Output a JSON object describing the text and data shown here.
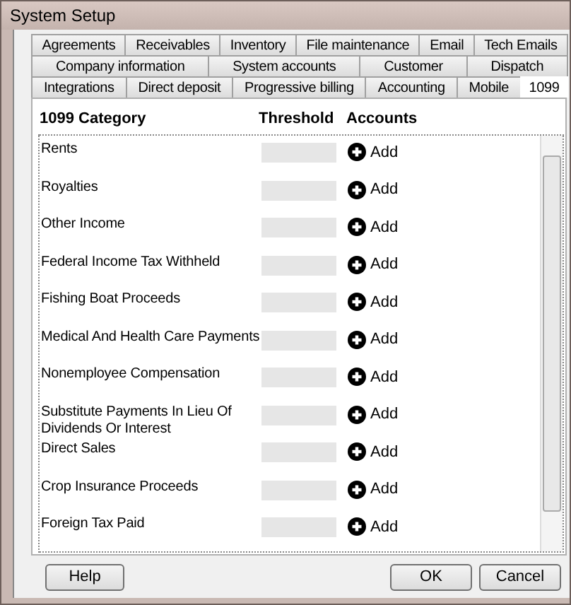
{
  "window": {
    "title": "System Setup"
  },
  "tab_rows": [
    [
      {
        "label": "Agreements",
        "selected": false
      },
      {
        "label": "Receivables",
        "selected": false
      },
      {
        "label": "Inventory",
        "selected": false
      },
      {
        "label": "File maintenance",
        "selected": false
      },
      {
        "label": "Email",
        "selected": false
      },
      {
        "label": "Tech Emails",
        "selected": false
      }
    ],
    [
      {
        "label": "Company information",
        "selected": false
      },
      {
        "label": "System accounts",
        "selected": false
      },
      {
        "label": "Customer",
        "selected": false
      },
      {
        "label": "Dispatch",
        "selected": false
      }
    ],
    [
      {
        "label": "Integrations",
        "selected": false
      },
      {
        "label": "Direct deposit",
        "selected": false
      },
      {
        "label": "Progressive billing",
        "selected": false
      },
      {
        "label": "Accounting",
        "selected": false
      },
      {
        "label": "Mobile",
        "selected": false
      },
      {
        "label": "1099",
        "selected": true
      }
    ]
  ],
  "table": {
    "columns": [
      "1099 Category",
      "Threshold",
      "Accounts"
    ],
    "rows": [
      {
        "category": "Rents",
        "action": "Add"
      },
      {
        "category": "Royalties",
        "action": "Add"
      },
      {
        "category": "Other Income",
        "action": "Add"
      },
      {
        "category": "Federal Income Tax Withheld",
        "action": "Add"
      },
      {
        "category": "Fishing Boat Proceeds",
        "action": "Add"
      },
      {
        "category": "Medical And Health Care Payments",
        "action": "Add"
      },
      {
        "category": "Nonemployee Compensation",
        "action": "Add"
      },
      {
        "category": "Substitute Payments In Lieu Of Dividends Or Interest",
        "action": "Add"
      },
      {
        "category": "Direct Sales",
        "action": "Add"
      },
      {
        "category": "Crop Insurance Proceeds",
        "action": "Add"
      },
      {
        "category": "Foreign Tax Paid",
        "action": "Add"
      }
    ]
  },
  "buttons": {
    "left": [
      "Help"
    ],
    "right": [
      "OK",
      "Cancel"
    ]
  }
}
